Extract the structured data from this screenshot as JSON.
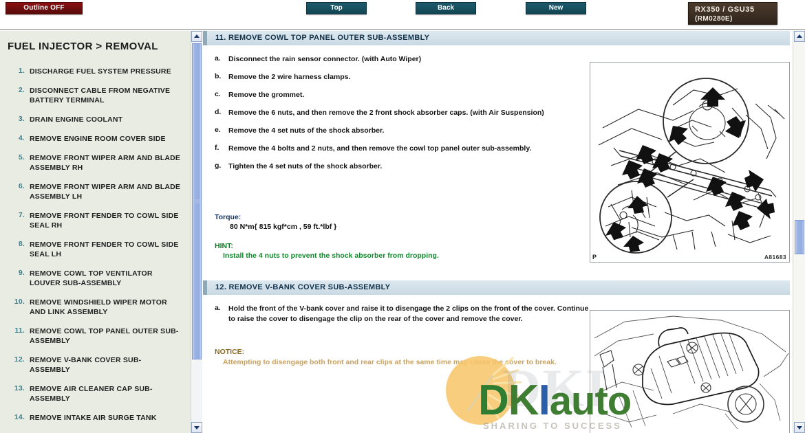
{
  "topbar": {
    "outline_button": "Outline OFF",
    "nav_buttons": [
      {
        "name": "top",
        "label": "Top"
      },
      {
        "name": "back",
        "label": "Back"
      },
      {
        "name": "new",
        "label": "New"
      }
    ],
    "model_badge": {
      "line1": "RX350 / GSU35",
      "line2": "(RM0280E)"
    },
    "colors": {
      "outline_button_bg": "#6d0d0d",
      "nav_button_bg": "#18505f",
      "model_badge_bg": "#3b2e22"
    }
  },
  "sidebar": {
    "title": "FUEL INJECTOR > REMOVAL",
    "items": [
      {
        "num": "1.",
        "label": "DISCHARGE FUEL SYSTEM PRESSURE"
      },
      {
        "num": "2.",
        "label": "DISCONNECT CABLE FROM NEGATIVE BATTERY TERMINAL"
      },
      {
        "num": "3.",
        "label": "DRAIN ENGINE COOLANT"
      },
      {
        "num": "4.",
        "label": "REMOVE ENGINE ROOM COVER SIDE"
      },
      {
        "num": "5.",
        "label": "REMOVE FRONT WIPER ARM AND BLADE ASSEMBLY RH"
      },
      {
        "num": "6.",
        "label": "REMOVE FRONT WIPER ARM AND BLADE ASSEMBLY LH"
      },
      {
        "num": "7.",
        "label": "REMOVE FRONT FENDER TO COWL SIDE SEAL RH"
      },
      {
        "num": "8.",
        "label": "REMOVE FRONT FENDER TO COWL SIDE SEAL LH"
      },
      {
        "num": "9.",
        "label": "REMOVE COWL TOP VENTILATOR LOUVER SUB-ASSEMBLY"
      },
      {
        "num": "10.",
        "label": "REMOVE WINDSHIELD WIPER MOTOR AND LINK ASSEMBLY"
      },
      {
        "num": "11.",
        "label": "REMOVE COWL TOP PANEL OUTER SUB-ASSEMBLY"
      },
      {
        "num": "12.",
        "label": "REMOVE V-BANK COVER SUB-ASSEMBLY"
      },
      {
        "num": "13.",
        "label": "REMOVE AIR CLEANER CAP SUB-ASSEMBLY"
      },
      {
        "num": "14.",
        "label": "REMOVE INTAKE AIR SURGE TANK"
      }
    ],
    "colors": {
      "bg": "#e8ece3",
      "number": "#3f7f8c",
      "text": "#1f1f1f"
    }
  },
  "main": {
    "sections": [
      {
        "heading": "11. REMOVE COWL TOP PANEL OUTER SUB-ASSEMBLY",
        "steps": [
          {
            "ltr": "a.",
            "text": "Disconnect the rain sensor connector. (with Auto Wiper)"
          },
          {
            "ltr": "b.",
            "text": "Remove the 2 wire harness clamps."
          },
          {
            "ltr": "c.",
            "text": "Remove the grommet."
          },
          {
            "ltr": "d.",
            "text": "Remove the 6 nuts, and then remove the 2 front shock absorber caps. (with Air Suspension)"
          },
          {
            "ltr": "e.",
            "text": "Remove the 4 set nuts of the shock absorber."
          },
          {
            "ltr": "f.",
            "text": "Remove the 4 bolts and 2 nuts, and then remove the cowl top panel outer sub-assembly."
          },
          {
            "ltr": "g.",
            "text": "Tighten the 4 set nuts of the shock absorber."
          }
        ],
        "torque_label": "Torque:",
        "torque_value": "80 N*m{ 815 kgf*cm , 59 ft.*lbf }",
        "hint_label": "HINT:",
        "hint_text": "Install the 4 nuts to prevent the shock absorber from dropping.",
        "figure": {
          "code": "A81683",
          "page_mark": "P"
        }
      },
      {
        "heading": "12. REMOVE V-BANK COVER SUB-ASSEMBLY",
        "steps": [
          {
            "ltr": "a.",
            "text": "Hold the front of the V-bank cover and raise it to disengage the 2 clips on the front of the cover. Continue to raise the cover to disengage the clip on the rear of the cover and remove the cover."
          }
        ],
        "notice_label": "NOTICE:",
        "notice_text": "Attempting to disengage both front and rear clips at the same time may cause the cover to break."
      }
    ],
    "colors": {
      "section_head_bg": "#d2e0e9",
      "section_head_text": "#11324a",
      "torque_text": "#10325e",
      "hint_text": "#0f8a2c",
      "notice_label": "#8a6a28",
      "notice_text": "#c9a25c"
    }
  },
  "watermark": {
    "ghost": "DKI",
    "part1": "D",
    "part2": "K",
    "part3": "I",
    "part4": "auto",
    "tagline": "SHARING TO SUCCESS"
  }
}
